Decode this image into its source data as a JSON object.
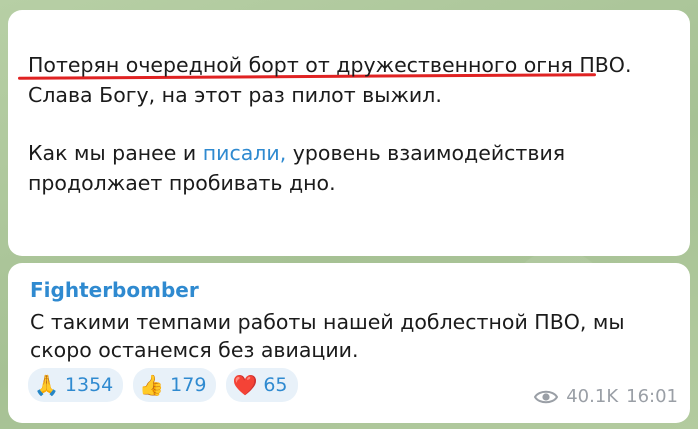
{
  "post": {
    "line1_underlined": "Потерян очередной борт от дружественного огня ПВО",
    "line1_rest": ". Слава Богу, на этот раз пилот выжил.",
    "para2_start": "Как мы ранее и ",
    "para2_link": "писали,",
    "para2_end": " уровень взаимодействия продолжает пробивать дно."
  },
  "reply": {
    "author": "Fighterbomber",
    "text": "С такими темпами работы нашей доблестной ПВО, мы скоро останемся без авиации."
  },
  "reactions": [
    {
      "emoji": "🙏",
      "icon": "folded-hands-icon",
      "count": "1354"
    },
    {
      "emoji": "👍",
      "icon": "thumbs-up-icon",
      "count": "179"
    },
    {
      "emoji": "❤️",
      "icon": "heart-icon",
      "count": "65"
    }
  ],
  "meta": {
    "views": "40.1K",
    "time": "16:01"
  },
  "colors": {
    "link": "#2f8ad0",
    "underline": "#e02222",
    "reaction_bg": "#e8f1f9",
    "chat_bg": "#a9c49c"
  }
}
